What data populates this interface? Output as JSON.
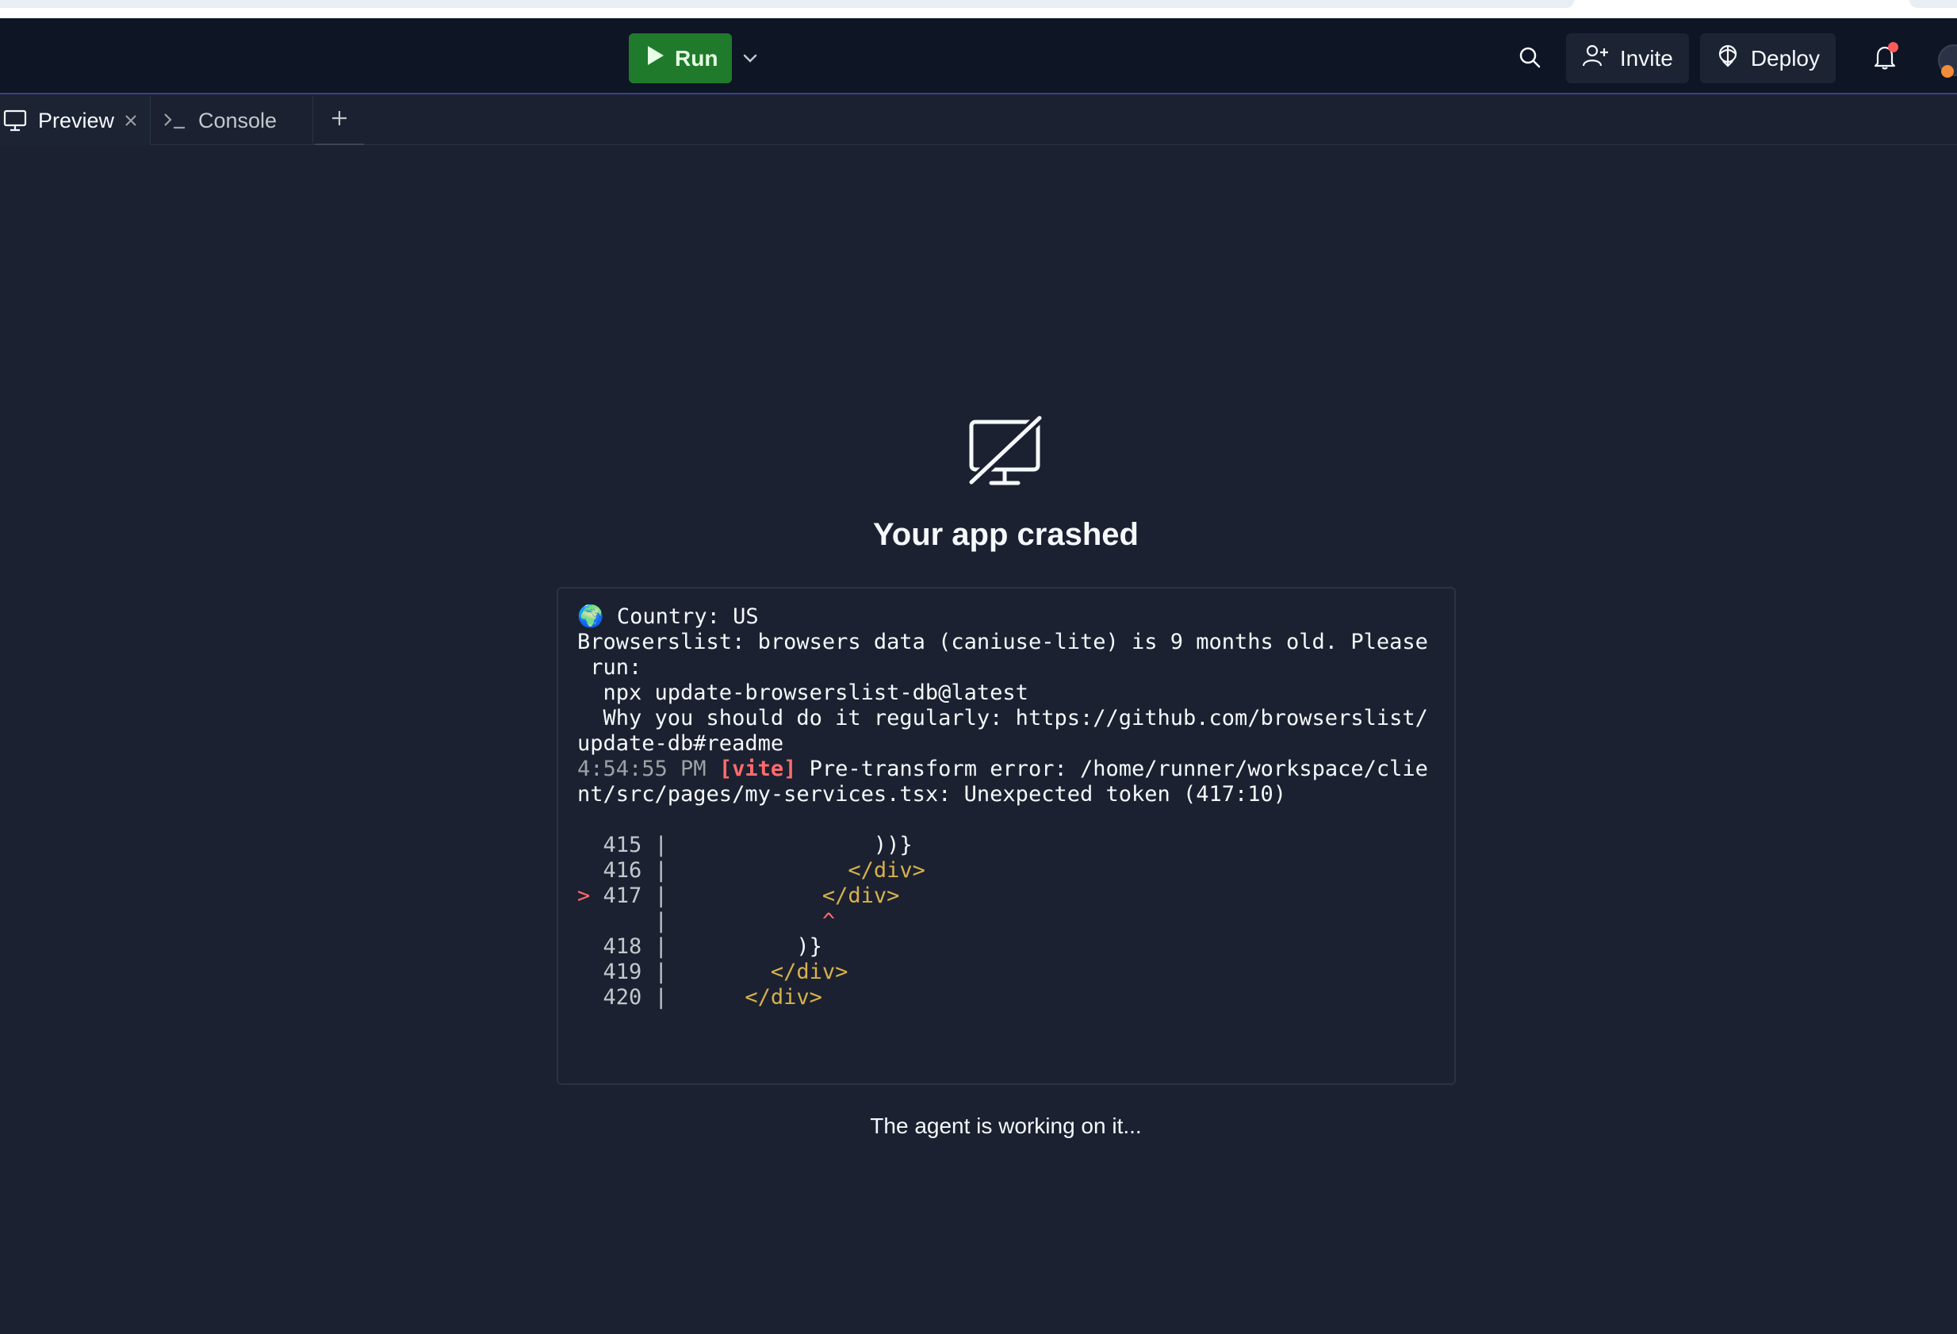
{
  "topbar": {
    "run_label": "Run",
    "invite_label": "Invite",
    "deploy_label": "Deploy",
    "run_color": "#1f7a2b"
  },
  "tabs": [
    {
      "label": "Preview",
      "icon": "monitor-icon"
    },
    {
      "label": "Console",
      "icon": "terminal-icon"
    }
  ],
  "crash": {
    "title": "Your app crashed",
    "status": "The agent is working on it..."
  },
  "log": {
    "line1": " Country: US",
    "line2": "Browserslist: browsers data (caniuse-lite) is 9 months old. Please",
    "line3": " run:",
    "line4": "  npx update-browserslist-db@latest",
    "line5": "  Why you should do it regularly: https://github.com/browserslist/",
    "line6": "update-db#readme",
    "time": "4:54:55 PM",
    "vite_tag": "[vite]",
    "error_a": " Pre-transform error: /home/runner/workspace/clie",
    "error_b": "nt/src/pages/my-services.tsx: Unexpected token (417:10)",
    "code": [
      {
        "marker": "  ",
        "num": "415",
        "indent": "               ",
        "text": "))}"
      },
      {
        "marker": "  ",
        "num": "416",
        "indent": "             ",
        "text": "</div>"
      },
      {
        "marker": "> ",
        "num": "417",
        "indent": "           ",
        "text": "</div>"
      },
      {
        "marker": "  ",
        "num": "   ",
        "indent": "           ",
        "text": "^"
      },
      {
        "marker": "  ",
        "num": "418",
        "indent": "         ",
        "text": ")}"
      },
      {
        "marker": "  ",
        "num": "419",
        "indent": "       ",
        "text": "</div>"
      },
      {
        "marker": "  ",
        "num": "420",
        "indent": "     ",
        "text": "</div>"
      }
    ]
  }
}
